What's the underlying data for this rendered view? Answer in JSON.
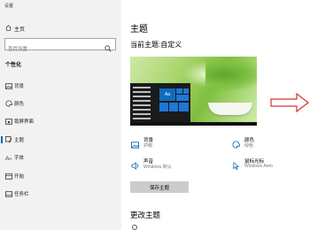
{
  "app": {
    "title": "设置"
  },
  "sidebar": {
    "home_label": "主页",
    "search_placeholder": "查找设置",
    "group_label": "个性化",
    "items": [
      {
        "label": "背景",
        "icon": "picture-icon"
      },
      {
        "label": "颜色",
        "icon": "palette-icon"
      },
      {
        "label": "锁屏界面",
        "icon": "lock-screen-icon"
      },
      {
        "label": "主题",
        "icon": "brush-icon",
        "active": true
      },
      {
        "label": "字体",
        "icon": "font-icon"
      },
      {
        "label": "开始",
        "icon": "start-icon"
      },
      {
        "label": "任务栏",
        "icon": "taskbar-icon"
      }
    ]
  },
  "main": {
    "title": "主题",
    "current_theme": "当前主题:自定义",
    "settings": {
      "background": {
        "label": "背景",
        "value": "护眼"
      },
      "color": {
        "label": "颜色",
        "value": "绿色"
      },
      "sound": {
        "label": "声音",
        "value": "Windows 默认"
      },
      "cursor": {
        "label": "鼠标光标",
        "value": "Windows Aero"
      }
    },
    "save_button": "保存主题",
    "change_theme": "更改主题",
    "preview_tile_text": "Aa"
  },
  "colors": {
    "accent": "#0063b1",
    "preview_tile": "#0f6cbd",
    "arrow": "#d9342b"
  }
}
